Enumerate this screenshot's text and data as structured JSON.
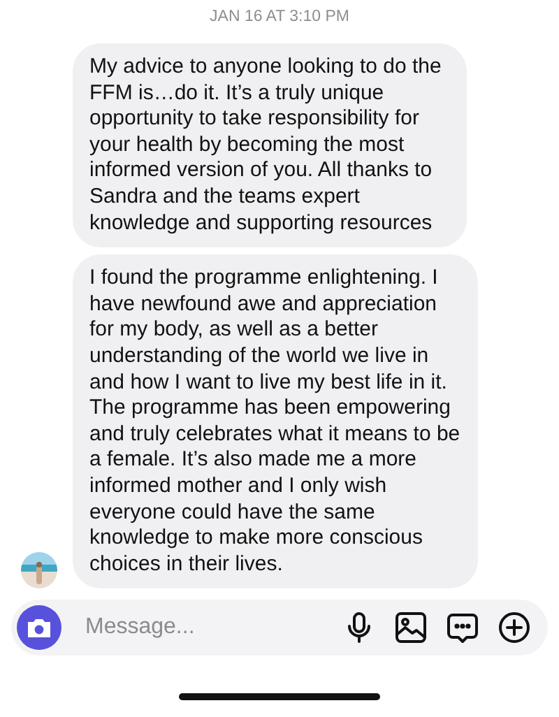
{
  "timestamp": "JAN 16 AT 3:10 PM",
  "messages": [
    {
      "text": "My advice to anyone looking to do the FFM is…do it. It’s a truly unique opportunity to take responsibility for your health by becoming the most informed version of you. All thanks to Sandra and the teams expert knowledge and supporting resources",
      "avatar": false
    },
    {
      "text": "I found the programme enlightening. I have newfound awe and appreciation for my body, as well as a better understanding of the world we live in and how I want to live my best life in it. The programme has been empowering and truly celebrates what it means to be a female. It’s also made me a more informed mother and I only wish everyone could have the same knowledge to make more conscious choices in their lives.",
      "avatar": true
    }
  ],
  "composer": {
    "placeholder": "Message..."
  }
}
